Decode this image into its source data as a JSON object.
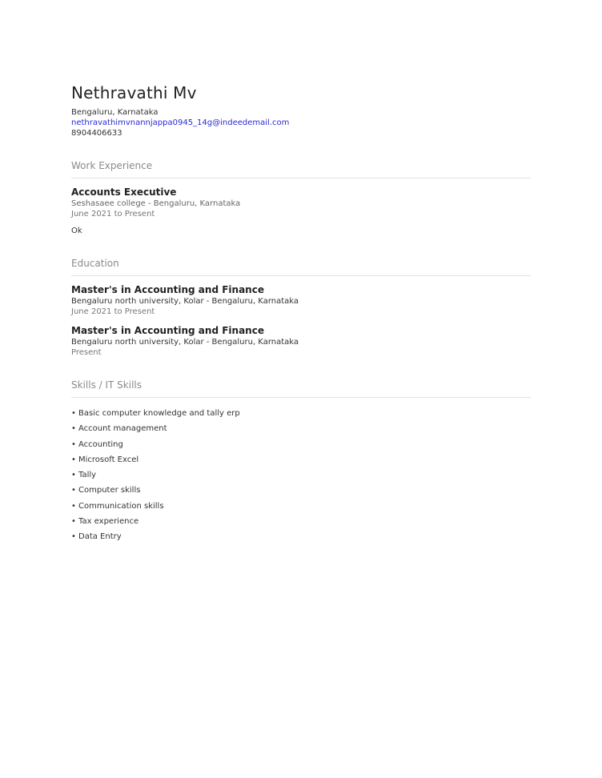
{
  "profile": {
    "name": "Nethravathi Mv",
    "location": "Bengaluru, Karnataka",
    "email": "nethravathimvnannjappa0945_14g@indeedemail.com",
    "phone": "8904406633"
  },
  "work": {
    "title": "Work Experience",
    "items": [
      {
        "role": "Accounts Executive",
        "company": "Seshasaee college - Bengaluru, Karnataka",
        "dates": "June 2021 to Present",
        "description": "Ok"
      }
    ]
  },
  "education": {
    "title": "Education",
    "items": [
      {
        "degree": "Master's in Accounting and Finance",
        "school": "Bengaluru north university, Kolar - Bengaluru, Karnataka",
        "dates": "June 2021 to Present"
      },
      {
        "degree": "Master's in Accounting and Finance",
        "school": "Bengaluru north university, Kolar - Bengaluru, Karnataka",
        "dates": "Present"
      }
    ]
  },
  "skills": {
    "title": "Skills / IT Skills",
    "items": [
      "Basic computer knowledge and tally erp",
      "Account management",
      "Accounting",
      "Microsoft Excel",
      "Tally",
      "Computer skills",
      "Communication skills",
      "Tax experience",
      "Data Entry"
    ]
  }
}
